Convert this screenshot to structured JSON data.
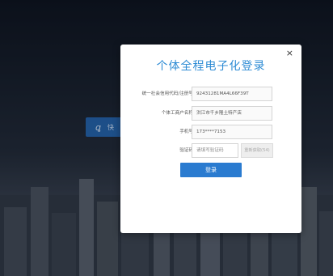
{
  "modal": {
    "title": "个体全程电子化登录",
    "close_symbol": "×"
  },
  "form": {
    "credit_code": {
      "label": "统一社会信用代码/注册号",
      "value": "92431281MA4L66F39T"
    },
    "business_name": {
      "label": "个体工商户名称",
      "value": "洪江市千乡隆土特产店"
    },
    "phone": {
      "label": "手机号",
      "value": "173****7153"
    },
    "verify_code": {
      "label": "验证码",
      "placeholder": "请填写验证码",
      "resend_label": "重新获取(54)"
    },
    "login_label": "登录"
  },
  "background": {
    "button_label": "快"
  },
  "colors": {
    "title": "#2d8bd4",
    "login_button": "#2a7bd0",
    "background_button": "#1f5fa8"
  }
}
